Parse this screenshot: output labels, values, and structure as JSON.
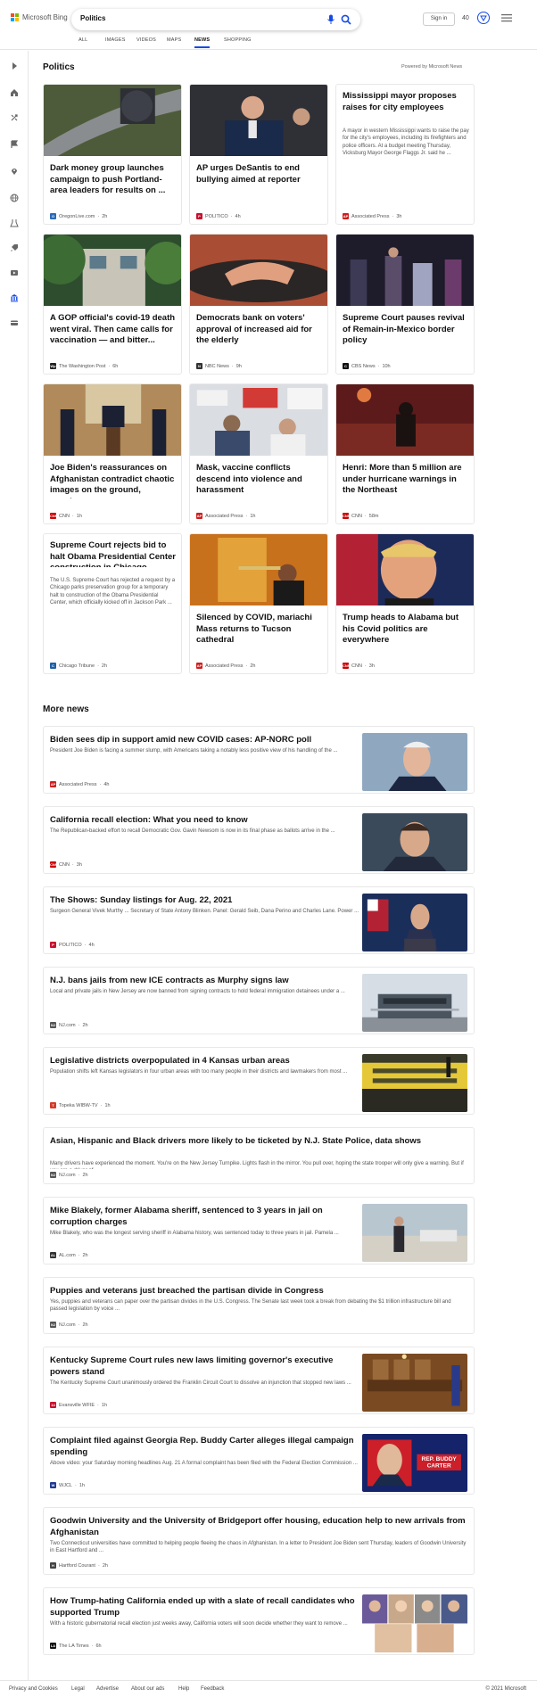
{
  "header": {
    "brand": "Microsoft Bing",
    "search_value": "Politics",
    "signin": "Sign in",
    "points": "40",
    "tabs": [
      "ALL",
      "IMAGES",
      "VIDEOS",
      "MAPS",
      "NEWS",
      "SHOPPING"
    ],
    "active_tab": "NEWS"
  },
  "section": {
    "title": "Politics",
    "powered": "Powered by Microsoft News"
  },
  "cards": [
    {
      "title": "Dark money group launches campaign to push Portland-area leaders for results on ...",
      "source": "OregonLive.com",
      "age": "2h",
      "src_icon": "O",
      "src_color": "#2a6ab7",
      "snippet": "",
      "image": "aerial-highway"
    },
    {
      "title": "AP urges DeSantis to end bullying aimed at reporter",
      "source": "POLITICO",
      "age": "4h",
      "src_icon": "P",
      "src_color": "#c8102e",
      "snippet": "",
      "image": "desantis-podium"
    },
    {
      "title": "Mississippi mayor proposes raises for city employees",
      "source": "Associated Press",
      "age": "3h",
      "src_icon": "AP",
      "src_color": "#d11d1d",
      "snippet": "A mayor in western Mississippi wants to raise the pay for the city's employees, including its firefighters and police officers. At a budget meeting Thursday, Vicksburg Mayor George Flaggs Jr. said he ...",
      "image": ""
    },
    {
      "title": "A GOP official's covid-19 death went viral. Then came calls for vaccination — and bitter...",
      "source": "The Washington Post",
      "age": "6h",
      "src_icon": "Wp",
      "src_color": "#222222",
      "snippet": "",
      "image": "green-building"
    },
    {
      "title": "Democrats bank on voters' approval of increased aid for the elderly",
      "source": "NBC News",
      "age": "9h",
      "src_icon": "N",
      "src_color": "#333333",
      "snippet": "",
      "image": "hands-wheel"
    },
    {
      "title": "Supreme Court pauses revival of Remain-in-Mexico border policy",
      "source": "CBS News",
      "age": "10h",
      "src_icon": "C",
      "src_color": "#111111",
      "snippet": "",
      "image": "border-night"
    },
    {
      "title": "Joe Biden's reassurances on Afghanistan contradict chaotic images on the ground, cappin...",
      "source": "CNN",
      "age": "1h",
      "src_icon": "CNN",
      "src_color": "#cc0000",
      "snippet": "",
      "image": "biden-room"
    },
    {
      "title": "Mask, vaccine conflicts descend into violence and harassment",
      "source": "Associated Press",
      "age": "1h",
      "src_icon": "AP",
      "src_color": "#d11d1d",
      "snippet": "",
      "image": "protest-signs"
    },
    {
      "title": "Henri: More than 5 million are under hurricane warnings in the Northeast",
      "source": "CNN",
      "age": "58m",
      "src_icon": "CNN",
      "src_color": "#cc0000",
      "snippet": "",
      "image": "rain-person"
    },
    {
      "title": "Supreme Court rejects bid to halt Obama Presidential Center construction in Chicago",
      "source": "Chicago Tribune",
      "age": "2h",
      "src_icon": "C",
      "src_color": "#1f5fa8",
      "snippet": "The U.S. Supreme Court has rejected a request by a Chicago parks preservation group for a temporary halt to construction of the Obama Presidential Center, which officially kicked off in Jackson Park ...",
      "image": ""
    },
    {
      "title": "Silenced by COVID, mariachi Mass returns to Tucson cathedral",
      "source": "Associated Press",
      "age": "2h",
      "src_icon": "AP",
      "src_color": "#d11d1d",
      "snippet": "",
      "image": "mariachi"
    },
    {
      "title": "Trump heads to Alabama but his Covid politics are everywhere",
      "source": "CNN",
      "age": "3h",
      "src_icon": "CNN",
      "src_color": "#cc0000",
      "snippet": "",
      "image": "trump"
    }
  ],
  "more_news": {
    "title": "More news",
    "items": [
      {
        "title": "Biden sees dip in support amid new COVID cases: AP-NORC poll",
        "snippet": "President Joe Biden is facing a summer slump, with Americans taking a notably less positive view of his handling of the ...",
        "source": "Associated Press",
        "age": "4h",
        "src_icon": "AP",
        "src_color": "#d11d1d",
        "image": "biden-portrait"
      },
      {
        "title": "California recall election: What you need to know",
        "snippet": "The Republican-backed effort to recall Democratic Gov. Gavin Newsom is now in its final phase as ballots arrive in the ...",
        "source": "CNN",
        "age": "3h",
        "src_icon": "CNN",
        "src_color": "#cc0000",
        "image": "newsom"
      },
      {
        "title": "The Shows: Sunday listings for Aug. 22, 2021",
        "snippet": "Surgeon General Vivek Murthy ... Secretary of State Antony Blinken. Panel: Gerald Seib, Dana Perino and Charles Lane. Power ...",
        "source": "POLITICO",
        "age": "4h",
        "src_icon": "P",
        "src_color": "#c8102e",
        "image": "blinken"
      },
      {
        "title": "N.J. bans jails from new ICE contracts as Murphy signs law",
        "snippet": "Local and private jails in New Jersey are now banned from signing contracts to hold federal immigration detainees under a ...",
        "source": "NJ.com",
        "age": "2h",
        "src_icon": "NJ",
        "src_color": "#555555",
        "image": "jail-building"
      },
      {
        "title": "Legislative districts overpopulated in 4 Kansas urban areas",
        "snippet": "Population shifts left Kansas legislators in four urban areas with too many people in their districts and lawmakers from most ...",
        "source": "Topeka WIBW-TV",
        "age": "1h",
        "src_icon": "T",
        "src_color": "#d43b2a",
        "image": "kansas"
      },
      {
        "title": "Asian, Hispanic and Black drivers more likely to be ticketed by N.J. State Police, data shows",
        "snippet": "Many drivers have experienced the moment. You're on the New Jersey Turnpike. Lights flash in the mirror. You pull over, hoping the state trooper will only give a warning. But if you are a driver of ...",
        "source": "NJ.com",
        "age": "2h",
        "src_icon": "NJ",
        "src_color": "#555555",
        "image": ""
      },
      {
        "title": "Mike Blakely, former Alabama sheriff, sentenced to 3 years in jail on corruption charges",
        "snippet": "Mike Blakely, who was the longest serving sheriff in Alabama history, was sentenced today to three years in jail. Pamela ...",
        "source": "AL.com",
        "age": "2h",
        "src_icon": "AL",
        "src_color": "#333333",
        "image": "sheriff-walk"
      },
      {
        "title": "Puppies and veterans just breached the partisan divide in Congress",
        "snippet": "Yes, puppies and veterans can paper over the partisan divides in the U.S. Congress. The Senate last week took a break from debating the $1 trillion infrastructure bill and passed legislation by voice ...",
        "source": "NJ.com",
        "age": "2h",
        "src_icon": "NJ",
        "src_color": "#555555",
        "image": ""
      },
      {
        "title": "Kentucky Supreme Court rules new laws limiting governor's executive powers stand",
        "snippet": "The Kentucky Supreme Court unanimously ordered the Franklin Circuit Court to dissolve an injunction that stopped new laws ...",
        "source": "Evansville WFIE",
        "age": "1h",
        "src_icon": "14",
        "src_color": "#c8102e",
        "image": "courtroom"
      },
      {
        "title": "Complaint filed against Georgia Rep. Buddy Carter alleges illegal campaign spending",
        "snippet": "Above video: your Saturday morning headlines Aug. 21 A formal complaint has been filed with the Federal Election Commission ...",
        "source": "WJCL",
        "age": "1h",
        "src_icon": "W",
        "src_color": "#1f3a93",
        "image": "buddy-carter"
      },
      {
        "title": "Goodwin University and the University of Bridgeport offer housing, education help to new arrivals from Afghanistan",
        "snippet": "Two Connecticut universities have committed to helping people fleeing the chaos in Afghanistan. In a letter to President Joe Biden sent Thursday, leaders of Goodwin University in East Hartford and ...",
        "source": "Hartford Courant",
        "age": "2h",
        "src_icon": "H",
        "src_color": "#444444",
        "image": ""
      },
      {
        "title": "How Trump-hating California ended up with a slate of recall candidates who supported Trump",
        "snippet": "With a historic gubernatorial recall election just weeks away, California voters will soon decide whether they want to remove ...",
        "source": "The LA Times",
        "age": "6h",
        "src_icon": "LA",
        "src_color": "#111111",
        "image": "candidates-grid"
      }
    ]
  },
  "footer": {
    "links": [
      "Privacy and Cookies",
      "Legal",
      "Advertise",
      "About our ads",
      "Help",
      "Feedback"
    ],
    "copyright": "© 2021 Microsoft"
  },
  "colors": {
    "accent": "#174ae4",
    "logo": [
      "#f25022",
      "#7fba00",
      "#00a4ef",
      "#ffb900"
    ]
  }
}
